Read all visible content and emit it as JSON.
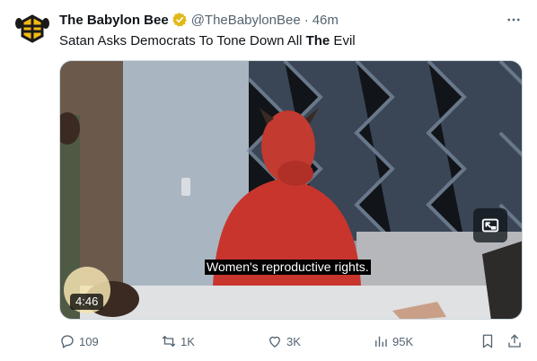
{
  "account": {
    "name": "The Babylon Bee",
    "handle": "@TheBabylonBee",
    "separator": "·",
    "time": "46m"
  },
  "tweet": {
    "text_before": "Satan Asks Democrats To Tone Down All ",
    "text_bold": "The",
    "text_after": " Evil"
  },
  "video": {
    "caption": "Women's reproductive rights.",
    "duration": "4:46"
  },
  "actions": {
    "replies": "109",
    "reposts": "1K",
    "likes": "3K",
    "views": "95K"
  },
  "icons": {
    "avatar": "babylon-bee-logo",
    "verified": "gold-verified-badge",
    "more": "more-dots-icon",
    "reply": "reply-icon",
    "repost": "repost-icon",
    "like": "heart-icon",
    "views": "views-chart-icon",
    "bookmark": "bookmark-icon",
    "share": "share-icon",
    "pip": "picture-in-picture-icon"
  },
  "colors": {
    "verified_gold": "#e2b719",
    "text_primary": "#0f1419",
    "text_secondary": "#536471"
  }
}
